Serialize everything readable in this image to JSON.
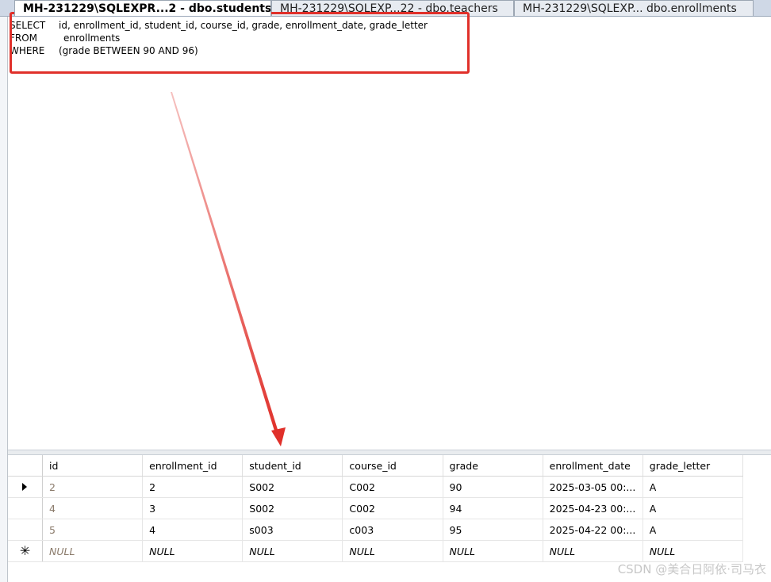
{
  "tabs": [
    {
      "label": "MH-231229\\SQLEXPR...2 - dbo.students*",
      "active": true
    },
    {
      "label": "MH-231229\\SQLEXP...22 - dbo.teachers",
      "active": false
    },
    {
      "label": "MH-231229\\SQLEXP... dbo.enrollments",
      "active": false
    }
  ],
  "sql": {
    "select_kw": "SELECT",
    "select_cols": "id, enrollment_id, student_id, course_id, grade, enrollment_date, grade_letter",
    "from_kw": "FROM",
    "from_table": "enrollments",
    "where_kw": "WHERE",
    "where_cond": "(grade BETWEEN 90 AND 96)"
  },
  "grid": {
    "columns": [
      "id",
      "enrollment_id",
      "student_id",
      "course_id",
      "grade",
      "enrollment_date",
      "grade_letter"
    ],
    "rows": [
      {
        "id": "2",
        "enrollment_id": "2",
        "student_id": "S002",
        "course_id": "C002",
        "grade": "90",
        "enrollment_date": "2025-03-05 00:...",
        "grade_letter": "A"
      },
      {
        "id": "4",
        "enrollment_id": "3",
        "student_id": "S002",
        "course_id": "C002",
        "grade": "94",
        "enrollment_date": "2025-04-23 00:...",
        "grade_letter": "A"
      },
      {
        "id": "5",
        "enrollment_id": "4",
        "student_id": "s003",
        "course_id": "c003",
        "grade": "95",
        "enrollment_date": "2025-04-22 00:...",
        "grade_letter": "A"
      }
    ],
    "new_row_value": "NULL",
    "current_row_icon": "row-pointer-icon",
    "new_row_icon": "new-row-asterisk-icon"
  },
  "watermark": "CSDN @美合日阿依·司马衣",
  "colors": {
    "highlight_box": "#e0302a",
    "arrow": "#e0302a",
    "tab_bar": "#cfd8e6"
  }
}
